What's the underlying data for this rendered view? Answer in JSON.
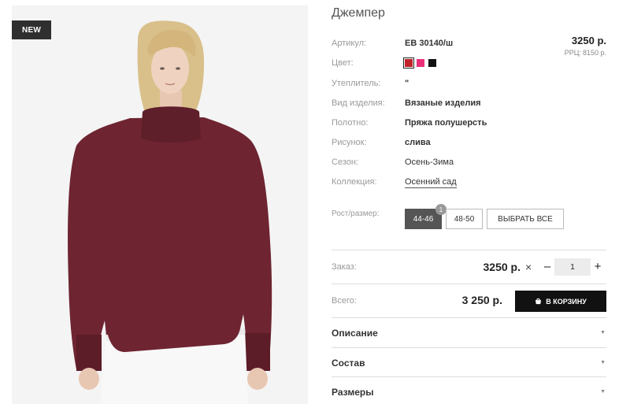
{
  "product": {
    "badge": "NEW",
    "title": "Джемпер",
    "price": "3250 р.",
    "rrp_label": "РРЦ:",
    "rrp_value": "8150 р."
  },
  "attributes": [
    {
      "label": "Артикул:",
      "value": "ЕВ 30140/ш"
    },
    {
      "label": "Цвет:",
      "value": ""
    },
    {
      "label": "Утеплитель:",
      "value": "\""
    },
    {
      "label": "Вид изделия:",
      "value": "Вязаные изделия"
    },
    {
      "label": "Полотно:",
      "value": "Пряжа полушерсть"
    },
    {
      "label": "Рисунок:",
      "value": "слива"
    },
    {
      "label": "Сезон:",
      "value": "Осень-Зима"
    },
    {
      "label": "Коллекция:",
      "value": "Осенний сад"
    }
  ],
  "colors": [
    {
      "name": "red",
      "hex": "#c0232a",
      "selected": true
    },
    {
      "name": "pink",
      "hex": "#ec2f7a",
      "selected": false
    },
    {
      "name": "black",
      "hex": "#111111",
      "selected": false
    }
  ],
  "sizes": {
    "label": "Рост/размер:",
    "options": [
      "44-46",
      "48-50"
    ],
    "selected": "44-46",
    "selected_count": "1",
    "select_all": "ВЫБРАТЬ ВСЕ"
  },
  "order": {
    "label": "Заказ:",
    "price": "3250 р.",
    "times": "×",
    "minus": "–",
    "plus": "+",
    "quantity": "1"
  },
  "total": {
    "label": "Всего:",
    "value": "3 250 р.",
    "cart_button": "В КОРЗИНУ"
  },
  "accordion": [
    "Описание",
    "Состав",
    "Размеры"
  ],
  "icons": {
    "cart": "cart-icon",
    "arrow": "triangle-down-icon"
  },
  "theme": {
    "accent": "#111111",
    "sweater": "#6e2431"
  }
}
